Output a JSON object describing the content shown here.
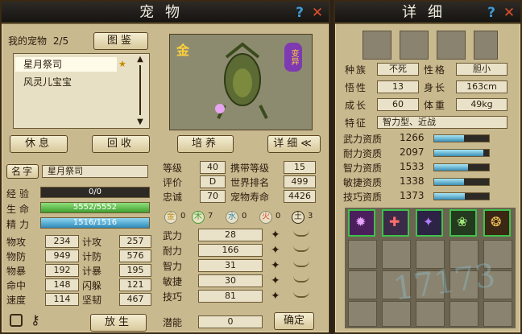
{
  "left": {
    "title": "宠物",
    "mypets_label": "我的宠物",
    "mypets_count": "2/5",
    "gallery_btn": "图鉴",
    "pets": [
      "星月祭司",
      "风灵儿宝宝"
    ],
    "element_badge": "金",
    "status_badge": "变异",
    "btn_rest": "休息",
    "btn_recall": "回收",
    "btn_train": "培养",
    "btn_detail": "详细",
    "name_label": "名字",
    "name_value": "星月祭司",
    "exp_label": "经验",
    "exp_value": "0/0",
    "hp_label": "生命",
    "hp_value": "5552/5552",
    "mp_label": "精力",
    "mp_value": "1516/1516",
    "stats": [
      {
        "l1": "物攻",
        "v1": "234",
        "l2": "计攻",
        "v2": "257"
      },
      {
        "l1": "物防",
        "v1": "949",
        "l2": "计防",
        "v2": "576"
      },
      {
        "l1": "物暴",
        "v1": "192",
        "l2": "计暴",
        "v2": "195"
      },
      {
        "l1": "命中",
        "v1": "148",
        "l2": "闪躲",
        "v2": "121"
      },
      {
        "l1": "速度",
        "v1": "114",
        "l2": "坚韧",
        "v2": "467"
      }
    ],
    "btn_release": "放生",
    "info": [
      {
        "l1": "等级",
        "v1": "40",
        "l2": "携带等级",
        "v2": "15"
      },
      {
        "l1": "评价",
        "v1": "D",
        "l2": "世界排名",
        "v2": "499"
      },
      {
        "l1": "忠诚",
        "v1": "70",
        "l2": "宠物寿命",
        "v2": "4426"
      }
    ],
    "elements": [
      {
        "name": "金",
        "value": "0"
      },
      {
        "name": "木",
        "value": "7"
      },
      {
        "name": "水",
        "value": "0"
      },
      {
        "name": "火",
        "value": "0"
      },
      {
        "name": "土",
        "value": "3"
      }
    ],
    "attrs": [
      {
        "label": "武力",
        "value": "28"
      },
      {
        "label": "耐力",
        "value": "166"
      },
      {
        "label": "智力",
        "value": "31"
      },
      {
        "label": "敏捷",
        "value": "30"
      },
      {
        "label": "技巧",
        "value": "81"
      }
    ],
    "potential_label": "潜能",
    "potential_value": "0",
    "confirm_btn": "确定"
  },
  "right": {
    "title": "详细",
    "race_label": "种族",
    "race_value": "不死",
    "temper_label": "性格",
    "temper_value": "胆小",
    "wit_label": "悟性",
    "wit_value": "13",
    "height_label": "身长",
    "height_value": "163cm",
    "growth_label": "成长",
    "growth_value": "60",
    "weight_label": "体重",
    "weight_value": "49kg",
    "trait_label": "特征",
    "trait_value": "智力型、近战",
    "aptitudes": [
      {
        "label": "武力资质",
        "value": "1266",
        "fill": 0.55
      },
      {
        "label": "耐力资质",
        "value": "2097",
        "fill": 0.9
      },
      {
        "label": "智力资质",
        "value": "1533",
        "fill": 0.62
      },
      {
        "label": "敏捷资质",
        "value": "1338",
        "fill": 0.55
      },
      {
        "label": "技巧资质",
        "value": "1373",
        "fill": 0.56
      }
    ],
    "watermark": "17173"
  }
}
